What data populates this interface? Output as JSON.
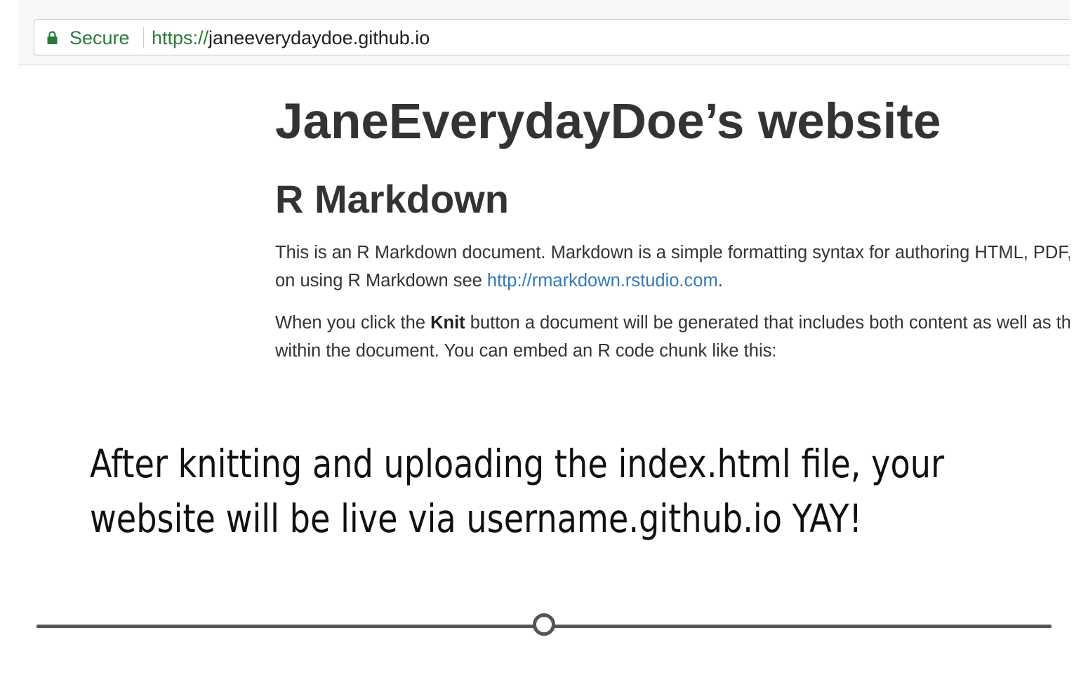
{
  "browser": {
    "security_label": "Secure",
    "url_scheme": "https://",
    "url_host": "janeeverydaydoe.github.io",
    "security_color": "#2b7a3a"
  },
  "page": {
    "site_title": "JaneEverydayDoe’s website",
    "section_heading": "R Markdown",
    "para1_line1": "This is an R Markdown document. Markdown is a simple formatting syntax for authoring HTML, PDF, and MS Word documents. For more details",
    "para1_line2_prefix": "on using R Markdown see ",
    "para1_link": "http://rmarkdown.rstudio.com",
    "para1_line2_suffix": ".",
    "para2_line1_prefix": "When you click the ",
    "para2_line1_bold": "Knit",
    "para2_line1_suffix": " button a document will be generated that includes both content as well as the output of any embedded R code chunks",
    "para2_line2": "within the document. You can embed an R code chunk like this:",
    "link_color": "#337ab7"
  },
  "caption": {
    "line1": "After knitting and uploading the index.html file, your",
    "line2": "website will be live via username.github.io YAY!"
  },
  "progress": {
    "position_fraction": 0.5
  }
}
